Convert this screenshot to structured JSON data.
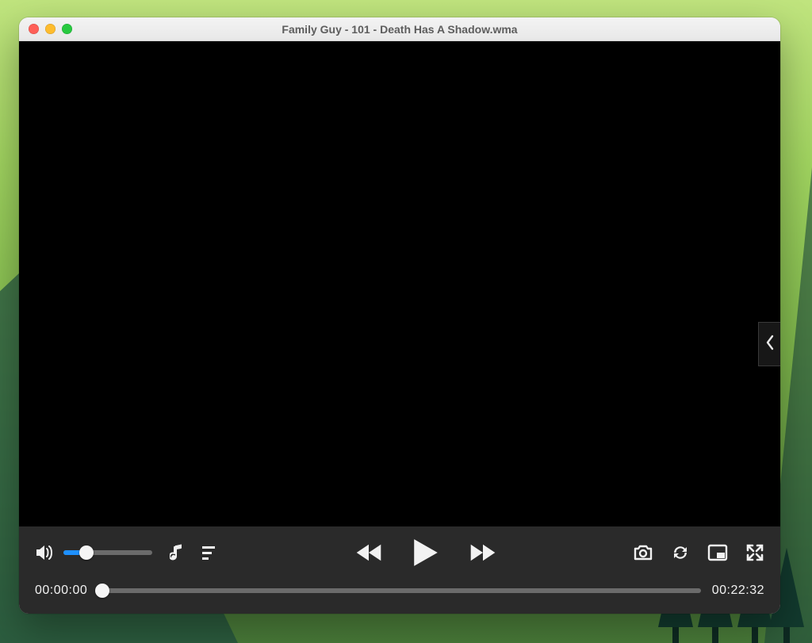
{
  "window": {
    "title": "Family Guy - 101 - Death Has A Shadow.wma"
  },
  "player": {
    "volume_percent": 26,
    "current_time": "00:00:00",
    "duration": "00:22:32",
    "progress_percent": 0.6
  },
  "icons": {
    "volume": "speaker-icon",
    "music": "music-note-icon",
    "playlist": "playlist-icon",
    "rewind": "rewind-icon",
    "play": "play-icon",
    "forward": "forward-icon",
    "snapshot": "camera-icon",
    "loop": "loop-icon",
    "pip": "picture-in-picture-icon",
    "fullscreen": "fullscreen-icon",
    "sidepanel": "chevron-left-icon"
  },
  "colors": {
    "control_bg": "#2a2a2a",
    "accent": "#1e90ff",
    "track": "#6b6b6b",
    "thumb": "#f5f5f5",
    "titlebar_text": "#5d5d5d"
  }
}
